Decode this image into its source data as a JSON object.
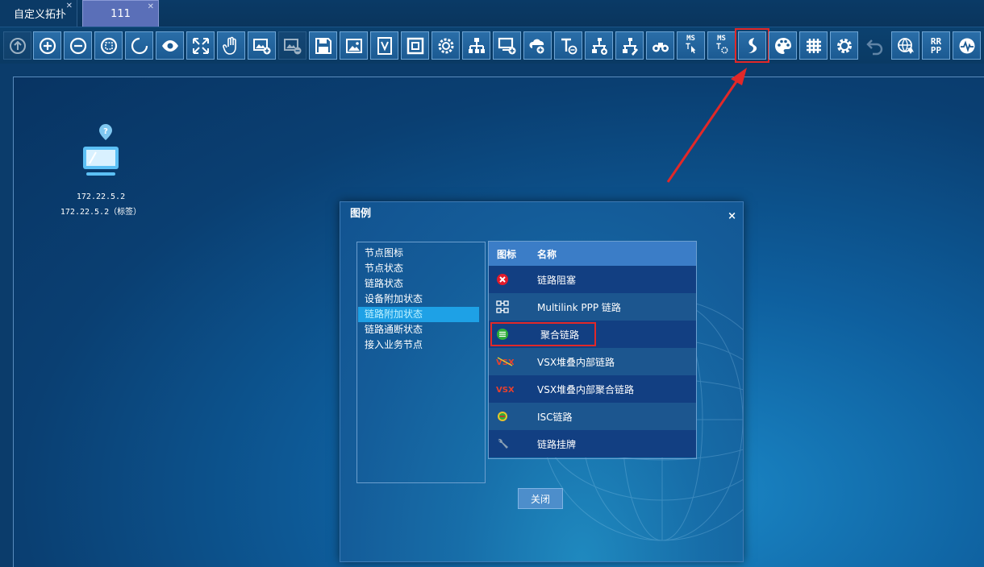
{
  "tabs": [
    {
      "label": "自定义拓扑"
    },
    {
      "label": "111"
    }
  ],
  "toolbar": {
    "icons": [
      "refresh-icon",
      "zoom-in-icon",
      "zoom-out-icon",
      "fit-view-icon",
      "select-icon",
      "eye-icon",
      "fullscreen-icon",
      "hand-icon",
      "add-image-icon",
      "remove-image-icon",
      "save-icon",
      "image-icon",
      "view-v-icon",
      "frame-icon",
      "gear-frame-icon",
      "topology-icon",
      "add-device-icon",
      "cloud-add-icon",
      "text-icon",
      "link-add-icon",
      "link-edit-icon",
      "binoculars-icon",
      "ms-ti-icon",
      "ms-t-icon",
      "legend-icon",
      "palette-icon",
      "grid-icon",
      "settings-icon",
      "undo-icon",
      "globe-filter-icon",
      "rrpp-icon",
      "monitor-icon"
    ],
    "ms_label": "MS",
    "rrpp_label": "RR PP"
  },
  "node": {
    "ip": "172.22.5.2",
    "label": "172.22.5.2（标签）"
  },
  "dialog": {
    "title": "图例",
    "close_x": "×",
    "categories": [
      "节点图标",
      "节点状态",
      "链路状态",
      "设备附加状态",
      "链路附加状态",
      "链路通断状态",
      "接入业务节点"
    ],
    "selected_index": 4,
    "table": {
      "col_icon": "图标",
      "col_name": "名称",
      "rows": [
        {
          "icon": "blocked-icon",
          "name": "链路阻塞"
        },
        {
          "icon": "multilink-icon",
          "name": "Multilink PPP 链路"
        },
        {
          "icon": "aggregate-icon",
          "name": "聚合链路"
        },
        {
          "icon": "vsx-icon",
          "name": "VSX堆叠内部链路"
        },
        {
          "icon": "vsx-text-icon",
          "name": "VSX堆叠内部聚合链路"
        },
        {
          "icon": "isc-icon",
          "name": "ISC链路"
        },
        {
          "icon": "wrench-icon",
          "name": "链路挂牌"
        }
      ]
    },
    "close_button": "关闭"
  },
  "vsx_text": "VSX",
  "colors": {
    "highlight": "#e22828",
    "selected": "#1ea1e6"
  }
}
